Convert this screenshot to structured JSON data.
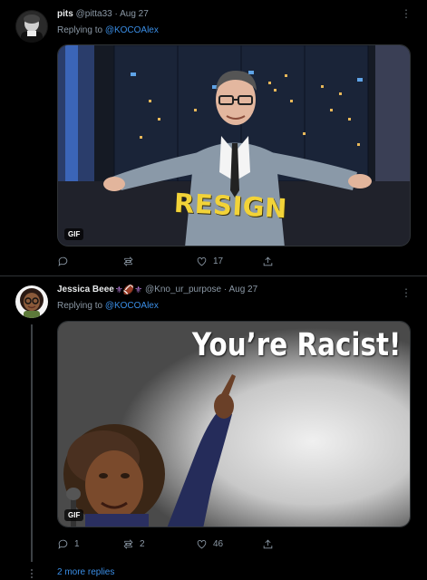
{
  "tweets": [
    {
      "name": "pits",
      "handle": "@pitta33",
      "separator": "·",
      "date": "Aug 27",
      "replying_label": "Replying to",
      "replying_handle": "@KOCOAlex",
      "media": {
        "type": "GIF",
        "badge": "GIF",
        "caption_text": "RESIGN"
      },
      "actions": {
        "reply_count": "",
        "retweet_count": "",
        "like_count": "17"
      }
    },
    {
      "name": "Jessica Beee",
      "name_emoji": "⚜🏈⚜",
      "handle": "@Kno_ur_purpose",
      "separator": "·",
      "date": "Aug 27",
      "replying_label": "Replying to",
      "replying_handle": "@KOCOAlex",
      "media": {
        "type": "GIF",
        "badge": "GIF",
        "caption_text": "You’re Racist!"
      },
      "actions": {
        "reply_count": "1",
        "retweet_count": "2",
        "like_count": "46"
      }
    }
  ],
  "more_icon": "ellipsis-icon",
  "more_replies_link": "2 more replies",
  "colors": {
    "background": "#000000",
    "link": "#3a8ee6",
    "muted": "#8b98a5",
    "gif_caption": "#f2d338"
  },
  "icons": [
    "reply-icon",
    "retweet-icon",
    "like-icon",
    "share-icon"
  ]
}
